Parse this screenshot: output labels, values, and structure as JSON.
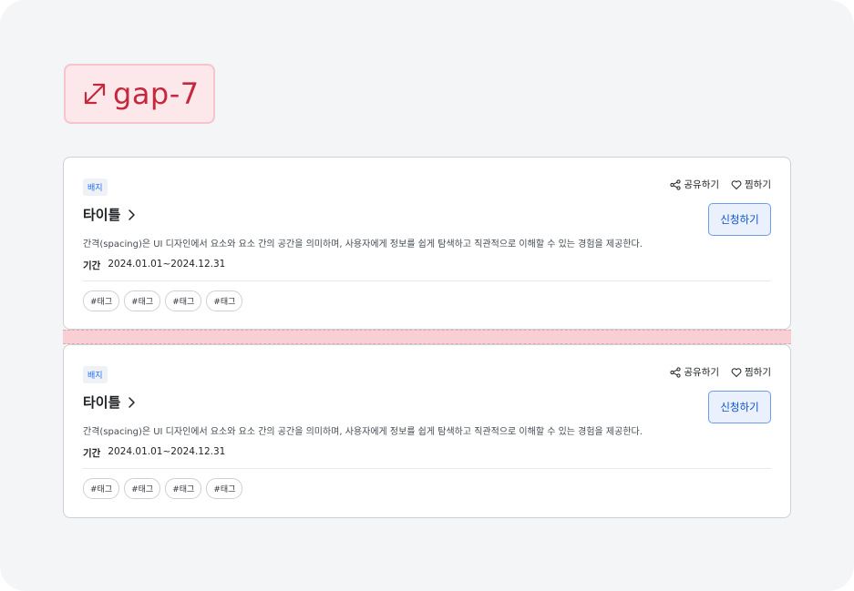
{
  "spacing_label": {
    "text": "gap-7",
    "icon": "diagonal-resize-arrow-icon",
    "color": "#c5283d"
  },
  "cards": [
    {
      "badge": "배지",
      "share_label": "공유하기",
      "like_label": "찜하기",
      "title": "타이틀",
      "apply_label": "신청하기",
      "description": "간격(spacing)은 UI 디자인에서 요소와 요소 간의 공간을 의미하며, 사용자에게 정보를 쉽게 탐색하고 직관적으로 이해할 수 있는 경험을 제공한다.",
      "period_label": "기간",
      "period_value": "2024.01.01~2024.12.31",
      "tags": [
        "#태그",
        "#태그",
        "#태그",
        "#태그"
      ]
    },
    {
      "badge": "배지",
      "share_label": "공유하기",
      "like_label": "찜하기",
      "title": "타이틀",
      "apply_label": "신청하기",
      "description": "간격(spacing)은 UI 디자인에서 요소와 요소 간의 공간을 의미하며, 사용자에게 정보를 쉽게 탐색하고 직관적으로 이해할 수 있는 경험을 제공한다.",
      "period_label": "기간",
      "period_value": "2024.01.01~2024.12.31",
      "tags": [
        "#태그",
        "#태그",
        "#태그",
        "#태그"
      ]
    }
  ],
  "colors": {
    "accent": "#256ef4",
    "gap_highlight": "#f7cfd5",
    "background": "#f4f5f7"
  }
}
